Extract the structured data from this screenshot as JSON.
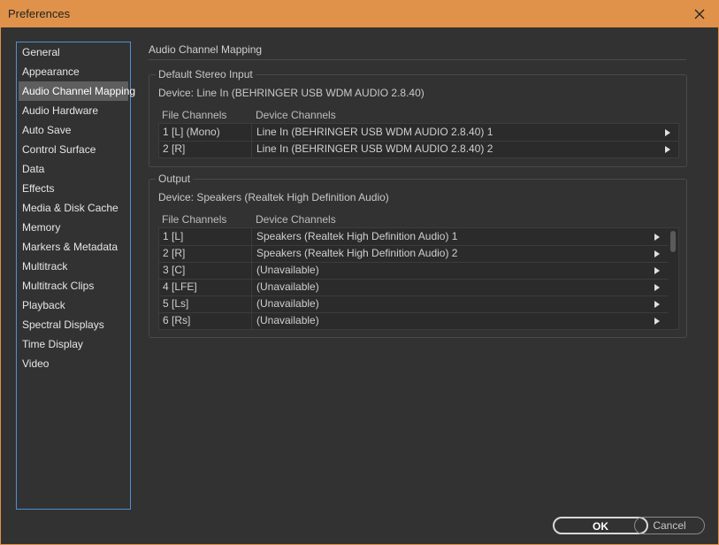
{
  "window": {
    "title": "Preferences",
    "close_icon": "close-icon"
  },
  "sidebar": {
    "items": [
      {
        "label": "General"
      },
      {
        "label": "Appearance"
      },
      {
        "label": "Audio Channel Mapping",
        "selected": true
      },
      {
        "label": "Audio Hardware"
      },
      {
        "label": "Auto Save"
      },
      {
        "label": "Control Surface"
      },
      {
        "label": "Data"
      },
      {
        "label": "Effects"
      },
      {
        "label": "Media & Disk Cache"
      },
      {
        "label": "Memory"
      },
      {
        "label": "Markers & Metadata"
      },
      {
        "label": "Multitrack"
      },
      {
        "label": "Multitrack Clips"
      },
      {
        "label": "Playback"
      },
      {
        "label": "Spectral Displays"
      },
      {
        "label": "Time Display"
      },
      {
        "label": "Video"
      }
    ]
  },
  "main": {
    "title": "Audio Channel Mapping",
    "input": {
      "legend": "Default Stereo Input",
      "device": "Device: Line In (BEHRINGER USB WDM AUDIO 2.8.40)",
      "col_file": "File Channels",
      "col_device": "Device Channels",
      "rows": [
        {
          "file": "1 [L] (Mono)",
          "device": "Line In (BEHRINGER USB WDM AUDIO 2.8.40) 1"
        },
        {
          "file": "2 [R]",
          "device": "Line In (BEHRINGER USB WDM AUDIO 2.8.40) 2"
        }
      ]
    },
    "output": {
      "legend": "Output",
      "device": "Device: Speakers (Realtek High Definition Audio)",
      "col_file": "File Channels",
      "col_device": "Device Channels",
      "rows": [
        {
          "file": "1 [L]",
          "device": "Speakers (Realtek High Definition Audio) 1"
        },
        {
          "file": "2 [R]",
          "device": "Speakers (Realtek High Definition Audio) 2"
        },
        {
          "file": "3 [C]",
          "device": "(Unavailable)"
        },
        {
          "file": "4 [LFE]",
          "device": "(Unavailable)"
        },
        {
          "file": "5 [Ls]",
          "device": "(Unavailable)"
        },
        {
          "file": "6 [Rs]",
          "device": "(Unavailable)"
        }
      ]
    }
  },
  "buttons": {
    "ok": "OK",
    "cancel": "Cancel"
  },
  "colors": {
    "titlebar": "#e0924a",
    "background": "#323232",
    "focus": "#4f8fd0"
  }
}
